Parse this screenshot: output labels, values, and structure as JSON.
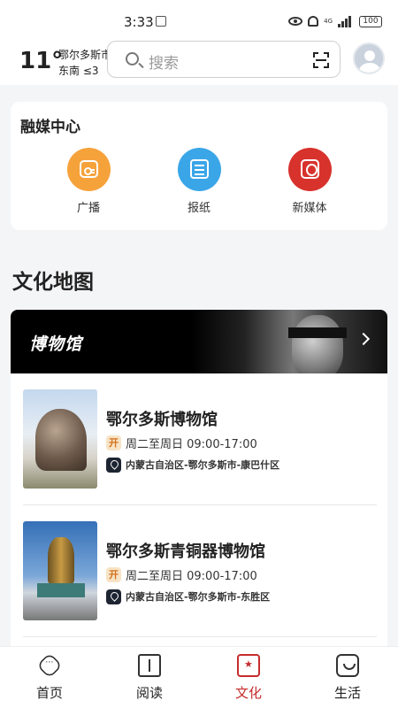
{
  "status_bar": {
    "time": "3:33",
    "network": "4G",
    "battery": "100"
  },
  "header": {
    "temperature": "11°",
    "city": "鄂尔多斯市",
    "wind": "东南 ≤3",
    "search_placeholder": "搜索"
  },
  "media_center": {
    "title": "融媒中心",
    "items": [
      {
        "label": "广播",
        "color": "#f6a23b",
        "icon": "radio-icon"
      },
      {
        "label": "报纸",
        "color": "#3aa6e8",
        "icon": "newspaper-icon"
      },
      {
        "label": "新媒体",
        "color": "#d8322c",
        "icon": "new-media-icon"
      }
    ]
  },
  "culture_map": {
    "title": "文化地图",
    "banner_label": "博物馆",
    "museums": [
      {
        "name": "鄂尔多斯博物馆",
        "open_badge": "开",
        "hours": "周二至周日 09:00-17:00",
        "address": "内蒙古自治区-鄂尔多斯市-康巴什区"
      },
      {
        "name": "鄂尔多斯青铜器博物馆",
        "open_badge": "开",
        "hours": "周二至周日 09:00-17:00",
        "address": "内蒙古自治区-鄂尔多斯市-东胜区"
      }
    ]
  },
  "tab_bar": {
    "active_color": "#c62c2c",
    "tabs": [
      {
        "label": "首页",
        "icon": "home-icon"
      },
      {
        "label": "阅读",
        "icon": "reading-icon"
      },
      {
        "label": "文化",
        "icon": "culture-icon"
      },
      {
        "label": "生活",
        "icon": "life-icon"
      }
    ]
  }
}
